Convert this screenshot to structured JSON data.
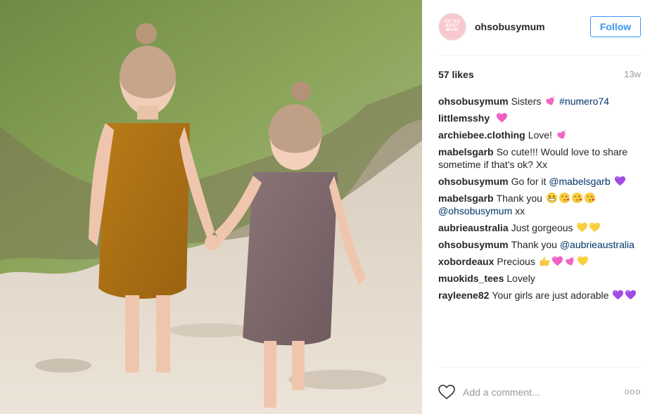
{
  "post": {
    "username": "ohsobusymum",
    "follow_label": "Follow",
    "avatar_label": "OH SO BUSY MUM",
    "likes": "57 likes",
    "time": "13w"
  },
  "comments": [
    {
      "user": "ohsobusymum",
      "text": "Sisters",
      "emoji": [
        "sparkle-heart"
      ],
      "tail_mention": "#numero74"
    },
    {
      "user": "littlemsshy",
      "text": "",
      "emoji": [
        "heart-pink"
      ]
    },
    {
      "user": "archiebee.clothing",
      "text": "Love!",
      "emoji": [
        "sparkle-heart"
      ]
    },
    {
      "user": "mabelsgarb",
      "text": "So cute!!! Would love to share sometime if that's ok? Xx",
      "emoji": []
    },
    {
      "user": "ohsobusymum",
      "text": "Go for it",
      "mention": "@mabelsgarb",
      "emoji": [
        "heart-purple"
      ]
    },
    {
      "user": "mabelsgarb",
      "text": "Thank you",
      "emoji": [
        "grin",
        "kiss",
        "kiss",
        "kiss"
      ],
      "mention": "@ohsobusymum",
      "tail": "xx"
    },
    {
      "user": "aubrieaustralia",
      "text": "Just gorgeous",
      "emoji": [
        "heart-yellow",
        "heart-yellow"
      ]
    },
    {
      "user": "ohsobusymum",
      "text": "Thank you",
      "mention": "@aubrieaustralia",
      "emoji": []
    },
    {
      "user": "xobordeaux",
      "text": "Precious",
      "emoji": [
        "thumbs-up",
        "heart-pink",
        "sparkle-heart",
        "heart-yellow"
      ]
    },
    {
      "user": "muokids_tees",
      "text": "Lovely",
      "emoji": []
    },
    {
      "user": "rayleene82",
      "text": "Your girls are just adorable",
      "emoji": [
        "heart-purple",
        "heart-purple"
      ]
    }
  ],
  "footer": {
    "placeholder": "Add a comment...",
    "more": "ooo"
  },
  "colors": {
    "accent": "#3897f0",
    "mention": "#003569",
    "muted": "#999999"
  }
}
